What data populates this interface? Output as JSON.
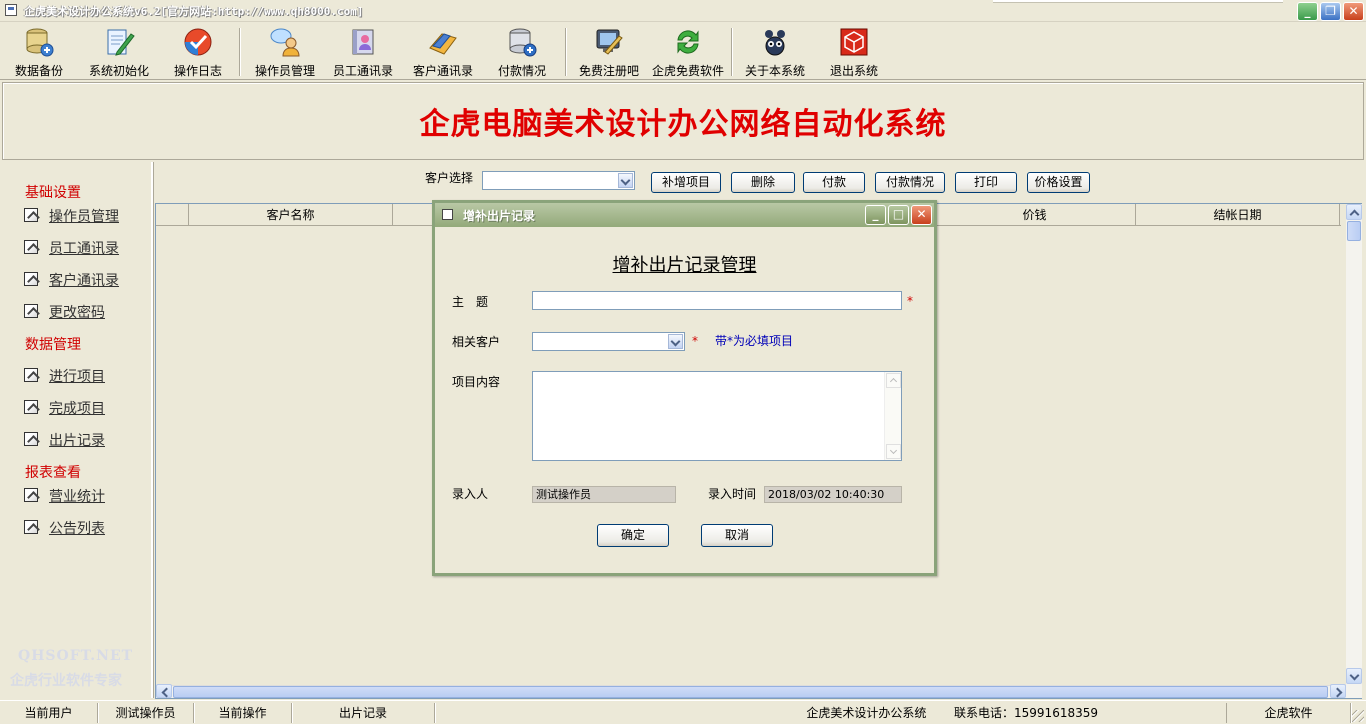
{
  "window": {
    "title": "企虎美术设计办公系统v6.2[官方网站:http://www.qh8000.com]"
  },
  "toolbar": {
    "items": [
      {
        "label": "数据备份",
        "icon": "database-backup-icon"
      },
      {
        "label": "系统初始化",
        "icon": "notepad-pencil-icon"
      },
      {
        "label": "操作日志",
        "icon": "checkmark-ball-icon"
      },
      {
        "label": "操作员管理",
        "icon": "users-chat-icon"
      },
      {
        "label": "员工通讯录",
        "icon": "address-book-icon"
      },
      {
        "label": "客户通讯录",
        "icon": "folder-contacts-icon"
      },
      {
        "label": "付款情况",
        "icon": "database-add-icon"
      },
      {
        "label": "免费注册吧",
        "icon": "monitor-disk-icon"
      },
      {
        "label": "企虎免费软件",
        "icon": "refresh-arrows-icon"
      },
      {
        "label": "关于本系统",
        "icon": "mascot-icon"
      },
      {
        "label": "退出系统",
        "icon": "exit-cube-icon"
      }
    ]
  },
  "banner": {
    "title": "企虎电脑美术设计办公网络自动化系统"
  },
  "sidebar": {
    "groups": [
      {
        "title": "基础设置",
        "items": [
          "操作员管理",
          "员工通讯录",
          "客户通讯录",
          "更改密码"
        ]
      },
      {
        "title": "数据管理",
        "items": [
          "进行项目",
          "完成项目",
          "出片记录"
        ]
      },
      {
        "title": "报表查看",
        "items": [
          "营业统计",
          "公告列表"
        ]
      }
    ],
    "watermark_site": "QHSOFT.NET",
    "watermark_slogan": "企虎行业软件专家"
  },
  "filter": {
    "label": "客户选择",
    "value": ""
  },
  "actions": [
    "补增项目",
    "删除",
    "付款",
    "付款情况",
    "打印",
    "价格设置"
  ],
  "table": {
    "columns": [
      "",
      "客户名称",
      "",
      "价钱",
      "结帐日期"
    ],
    "rows": []
  },
  "dialog": {
    "title": "增补出片记录",
    "heading": "增补出片记录管理",
    "subject_label": "主　题",
    "subject_value": "",
    "customer_label": "相关客户",
    "customer_value": "",
    "required_mark": "*",
    "hint": "带*为必填项目",
    "content_label": "项目内容",
    "content_value": "",
    "entered_by_label": "录入人",
    "entered_by_value": "测试操作员",
    "entry_time_label": "录入时间",
    "entry_time_value": "2018/03/02 10:40:30",
    "ok_label": "确定",
    "cancel_label": "取消"
  },
  "statusbar": {
    "current_user_label": "当前用户",
    "current_user_value": "测试操作员",
    "current_op_label": "当前操作",
    "current_op_value": "出片记录",
    "system_name": "企虎美术设计办公系统",
    "phone": "联系电话：15991618359",
    "vendor": "企虎软件"
  },
  "colors": {
    "banner_title": "#e00000",
    "sidebar_group": "#d00000",
    "hint": "#0000b8",
    "dialog_title_bar": "#93a97a"
  }
}
